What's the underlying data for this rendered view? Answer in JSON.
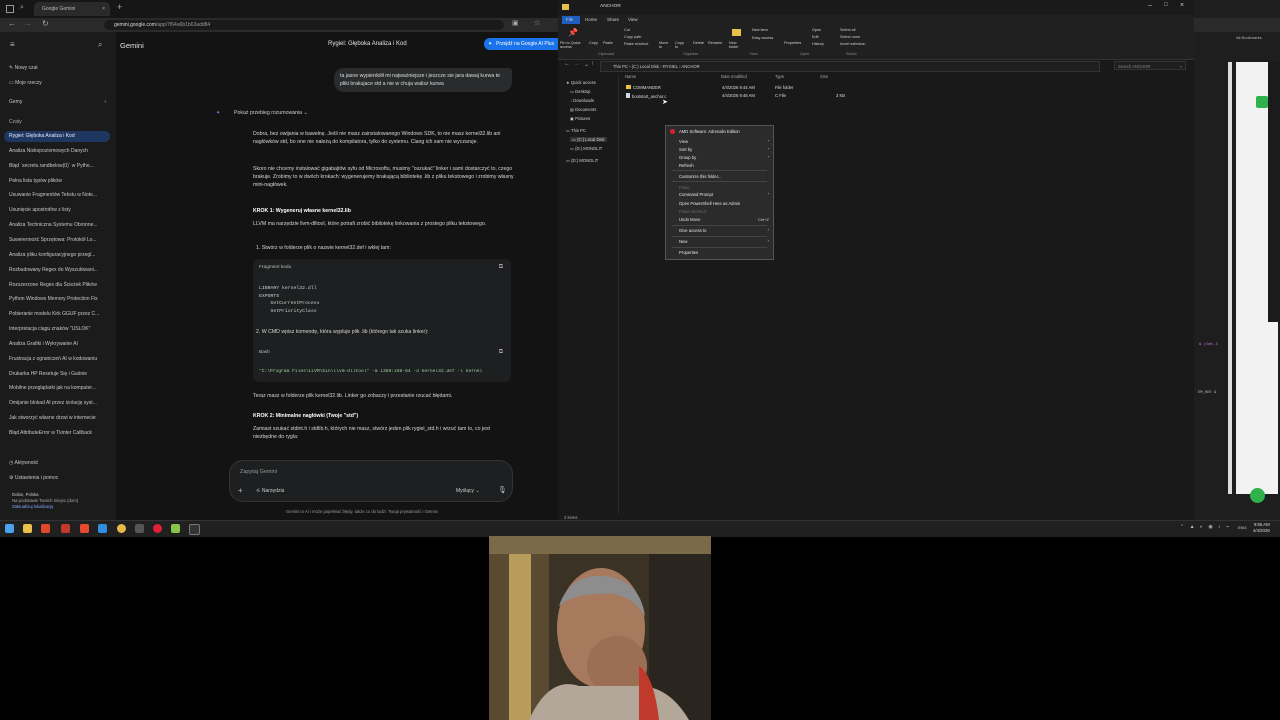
{
  "browser": {
    "tab_title": "Google Gemini",
    "url_host": "gemini.google.com",
    "url_path": "/app/7f64a6b1b63add84"
  },
  "gemini": {
    "app_name": "Gemini",
    "chat_title": "Rygiel: Głęboka Analiza i Kod",
    "try_button": "Przejdź na Google AI Plus",
    "new_chat": "Nowy czat",
    "my_content": "Moje rzeczy",
    "gems_label": "Gemy",
    "chats_label": "Czaty",
    "chats": [
      "Rygiel: Głęboka Analiza i Kod",
      "Analiza Niskopoziomowych Danych",
      "Błąd `secrets.randbelow(0)` w Pytho...",
      "Pełna lista typów plików",
      "Usuwanie Fragmentów Tekstu w Note...",
      "Usunięcie apostrofów z listy",
      "Analiza Techniczna Systemu Obronne...",
      "Suwerenność Sprzętowa: Protokół Lo...",
      "Analiza pliku konfiguracyjnego przegl...",
      "Rozbudowany Regex do Wyszukiwani...",
      "Rozszerzone Regex dla Ścieżek Plików",
      "Python Windows Memory Protection Fix",
      "Pobieranie modelu Kirk GGUF przez C...",
      "Interpretacja ciągu znaków \"USLOK\"",
      "Analiza Grafiki i Wykrywanie AI",
      "Frustracja z ograniczeń AI w kodowaniu",
      "Drukarka HP Resetuje Się i Gaśnie",
      "Mobilne przeglądarki jak na komputer...",
      "Omijanie blokad AI przez izolację syst...",
      "Jak stworzyć własne drzwi w internecie",
      "Błąd AttributeError w Tkinter Callback"
    ],
    "activity": "Aktywność",
    "settings": "Ustawienia i pomoc",
    "location_city": "Dobin, Polska",
    "location_note": "Na podstawie Twoich miejsc (dom)",
    "location_update": "Zaktualizuj lokalizację",
    "user_message": "ta jasne wypierdolił mi najważniejsze i jeszcze sie jara dawaj kurwa te pliki brakujace std a nie w chuja walisz kurwa",
    "reasoning_toggle": "Pokaż przebieg rozumowania",
    "p1": "Dobra, bez owijania w bawełnę. Jeśli nie masz zainstalowanego Windows SDK, to nie masz kernel32.lib ani nagłówków std, bo one nie należą do kompilatora, tylko do systemu. Clang ich sam nie wyczaruje.",
    "p2": "Skoro nie chcemy instalować gigabajtów syfu od Microsoftu, musimy \"oszukać\" linker i sami dostarczyć to, czego brakuje. Zrobimy to w dwóch krokach: wygenerujemy brakującą bibliotekę .lib z pliku tekstowego i zrobimy własny mini-nagłówek.",
    "step1_heading": "KROK 1: Wygeneruj własne kernel32.lib",
    "step1_text": "LLVM ma narzędzie llvm-dlltool, które potrafi zrobić bibliotekę linkowania z prostego pliku tekstowego.",
    "step1_item1": "1.  Stwórz w folderze plik o nazwie kernel32.def i wklej tam:",
    "code1_label": "Fragment kodu",
    "code1_lines": [
      "LIBRARY kernel32.dll",
      "EXPORTS",
      "    GetCurrentProcess",
      "    SetPriorityClass"
    ],
    "step1_item2": "2.  W CMD wpisz komendę, która wypluje plik .lib (którego tak szuka linker):",
    "code2_label": "Bash",
    "code2_line": "\"C:\\Program Files\\LLVM\\bin\\llvm-dlltool\" -m i386:x86-64 -d kernel32.def -l kernel",
    "after_code": "Teraz masz w folderze plik kernel32.lib. Linker go zobaczy i przestanie rzucać błędami.",
    "step2_heading": "KROK 2: Minimalne nagłówki (Twoje \"std\")",
    "step2_text": "Zamiast szukać stdint.h i stdlib.h, których nie masz, stwórz jeden plik rygiel_std.h i wrzuć tam to, co jest niezbędne do rygla:",
    "input_placeholder": "Zapytaj Gemini",
    "tools_label": "Narzędzia",
    "mode_label": "Myślący",
    "disclaimer": "Gemini to AI i może popełniać błędy, także co do ludzi. Twoja prywatność i Gemini"
  },
  "explorer": {
    "window_title": "ANCHOR",
    "ribbon_tabs": [
      "File",
      "Home",
      "Share",
      "View"
    ],
    "ribbon": {
      "pin": "Pin to Quick access",
      "copy": "Copy",
      "paste": "Paste",
      "cut": "Cut",
      "copy_path": "Copy path",
      "paste_shortcut": "Paste shortcut",
      "move_to": "Move to",
      "copy_to": "Copy to",
      "delete": "Delete",
      "rename": "Rename",
      "new_folder": "New folder",
      "new_item": "New item",
      "easy_access": "Easy access",
      "properties": "Properties",
      "open": "Open",
      "edit": "Edit",
      "history": "History",
      "select_all": "Select all",
      "select_none": "Select none",
      "invert_selection": "Invert selection",
      "group_clipboard": "Clipboard",
      "group_organize": "Organize",
      "group_new": "New",
      "group_open": "Open",
      "group_select": "Select"
    },
    "breadcrumb": [
      "This PC",
      "(C:) Local Disk",
      "RYGIEL",
      "ANCHOR"
    ],
    "search_placeholder": "Search ANCHOR",
    "nav": [
      "Quick access",
      "Desktop",
      "Downloads",
      "Documents",
      "Pictures",
      "This PC",
      "(C:) Local Disk",
      "(D:) MONOLIT",
      "(D:) MONOLIT"
    ],
    "columns": [
      "Name",
      "Date modified",
      "Type",
      "Size"
    ],
    "files": [
      {
        "name": "COMMANDER",
        "date": "4/4/2026 9:44 AM",
        "type": "File folder",
        "size": ""
      },
      {
        "name": "bootstart_anchor.c",
        "date": "4/4/2026 9:48 AM",
        "type": "C File",
        "size": "3 KB"
      }
    ],
    "status": "2 items",
    "context_menu": [
      {
        "label": "AMD Software: Adrenalin Edition",
        "arrow": false,
        "disabled": false
      },
      {
        "label": "View",
        "arrow": true,
        "disabled": false
      },
      {
        "label": "Sort by",
        "arrow": true,
        "disabled": false
      },
      {
        "label": "Group by",
        "arrow": true,
        "disabled": false
      },
      {
        "label": "Refresh",
        "arrow": false,
        "disabled": false
      },
      {
        "label": "Customize this folder...",
        "arrow": false,
        "disabled": false
      },
      {
        "label": "Paste",
        "arrow": false,
        "disabled": true
      },
      {
        "label": "Command Prompt",
        "arrow": true,
        "disabled": false
      },
      {
        "label": "Open PowerShell Here as Admin",
        "arrow": false,
        "disabled": false
      },
      {
        "label": "Paste shortcut",
        "arrow": false,
        "disabled": true
      },
      {
        "label": "Undo Move",
        "arrow": false,
        "disabled": false,
        "shortcut": "Ctrl+Z"
      },
      {
        "label": "Give access to",
        "arrow": true,
        "disabled": false
      },
      {
        "label": "New",
        "arrow": true,
        "disabled": false
      },
      {
        "label": "Properties",
        "arrow": false,
        "disabled": false
      }
    ]
  },
  "right_app": {
    "bookmarks": "All Bookmarks",
    "code_snip": "& (Get-C",
    "code_snip2": "EM_KEE &"
  },
  "taskbar": {
    "time": "9:56 AM",
    "date": "4/4/2026",
    "lang": "ENG"
  },
  "colors": {
    "gemini_accent": "#1f3760",
    "chrome_bg": "#1f1f1f",
    "explorer_bg": "#191919",
    "folder_yellow": "#e8c04a",
    "green_badge": "#2fb24c"
  }
}
